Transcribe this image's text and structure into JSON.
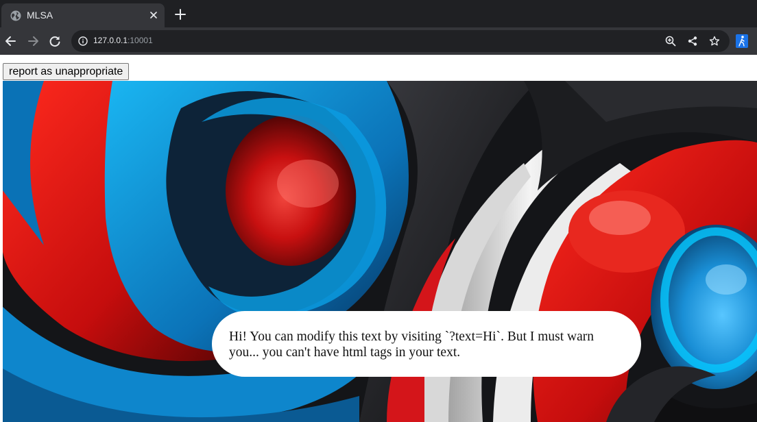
{
  "browser": {
    "tab_title": "MLSA",
    "url_host": "127.0.0.1",
    "url_port": ":10001"
  },
  "page": {
    "report_button_label": "report as unappropriate",
    "speech_text": "Hi! You can modify this text by visiting `?text=Hi`. But I must warn you... you can't have html tags in your text."
  },
  "colors": {
    "accent_red": "#e3131b",
    "accent_blue": "#0f9ce0",
    "chrome_dark": "#35363a"
  }
}
